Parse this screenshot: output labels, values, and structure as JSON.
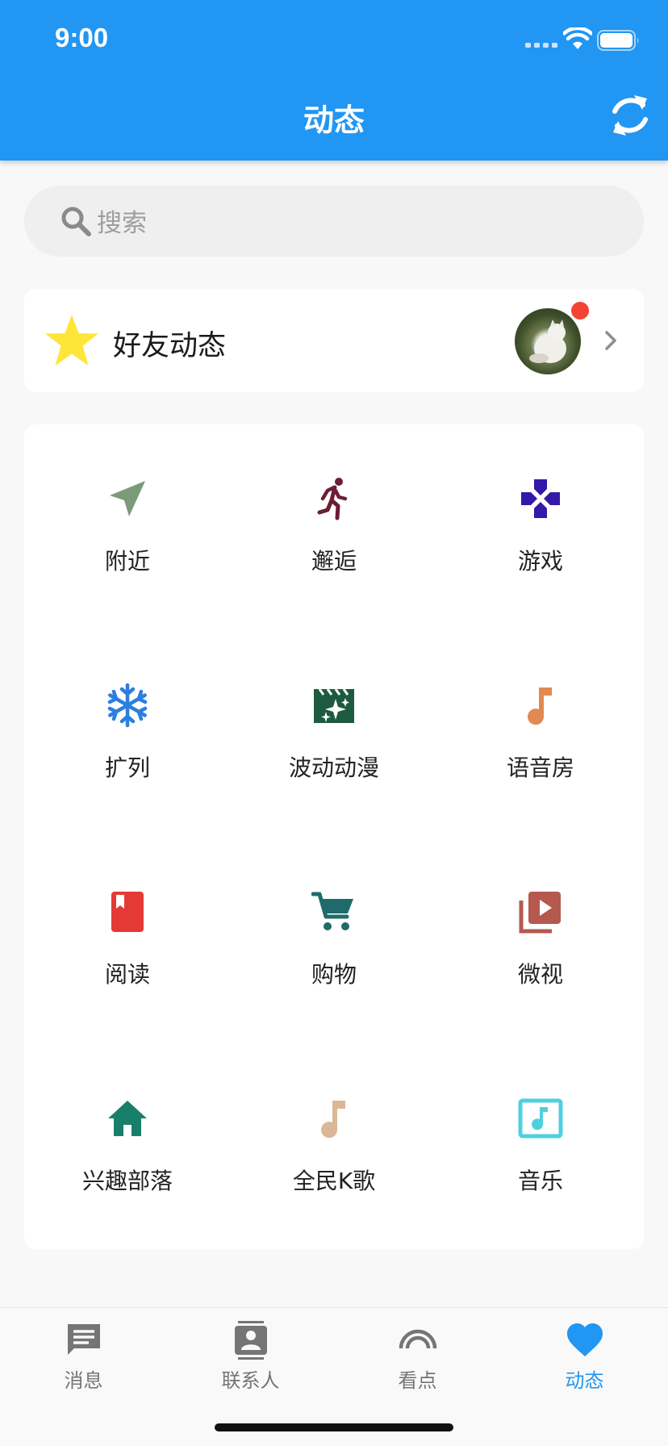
{
  "status_bar": {
    "time": "9:00"
  },
  "header": {
    "title": "动态",
    "refresh_icon": "refresh-icon",
    "background": "#2196f3"
  },
  "search": {
    "placeholder": "搜索"
  },
  "friends": {
    "label": "好友动态",
    "has_unread": true
  },
  "grid": {
    "items": [
      {
        "label": "附近",
        "icon": "navigation-icon",
        "color": "#7a9a78"
      },
      {
        "label": "邂逅",
        "icon": "running-person-icon",
        "color": "#6b1f34"
      },
      {
        "label": "游戏",
        "icon": "gamepad-icon",
        "color": "#3419a8"
      },
      {
        "label": "扩列",
        "icon": "snowflake-icon",
        "color": "#2b7fe0"
      },
      {
        "label": "波动动漫",
        "icon": "movie-filter-icon",
        "color": "#1d5a3f"
      },
      {
        "label": "语音房",
        "icon": "music-note-icon",
        "color": "#e08a52"
      },
      {
        "label": "阅读",
        "icon": "book-icon",
        "color": "#e53935"
      },
      {
        "label": "购物",
        "icon": "shopping-cart-icon",
        "color": "#1f6b6b"
      },
      {
        "label": "微视",
        "icon": "video-library-icon",
        "color": "#b5594f"
      },
      {
        "label": "兴趣部落",
        "icon": "home-icon",
        "color": "#1a7f6a"
      },
      {
        "label": "全民K歌",
        "icon": "music-note-icon",
        "color": "#dcb795"
      },
      {
        "label": "音乐",
        "icon": "music-video-icon",
        "color": "#4fd0e0"
      }
    ]
  },
  "bottom_nav": {
    "active_color": "#2196f3",
    "inactive_color": "#757575",
    "items": [
      {
        "label": "消息",
        "icon": "message-icon",
        "active": false
      },
      {
        "label": "联系人",
        "icon": "contacts-icon",
        "active": false
      },
      {
        "label": "看点",
        "icon": "rainbow-icon",
        "active": false
      },
      {
        "label": "动态",
        "icon": "heart-icon",
        "active": true
      }
    ]
  }
}
